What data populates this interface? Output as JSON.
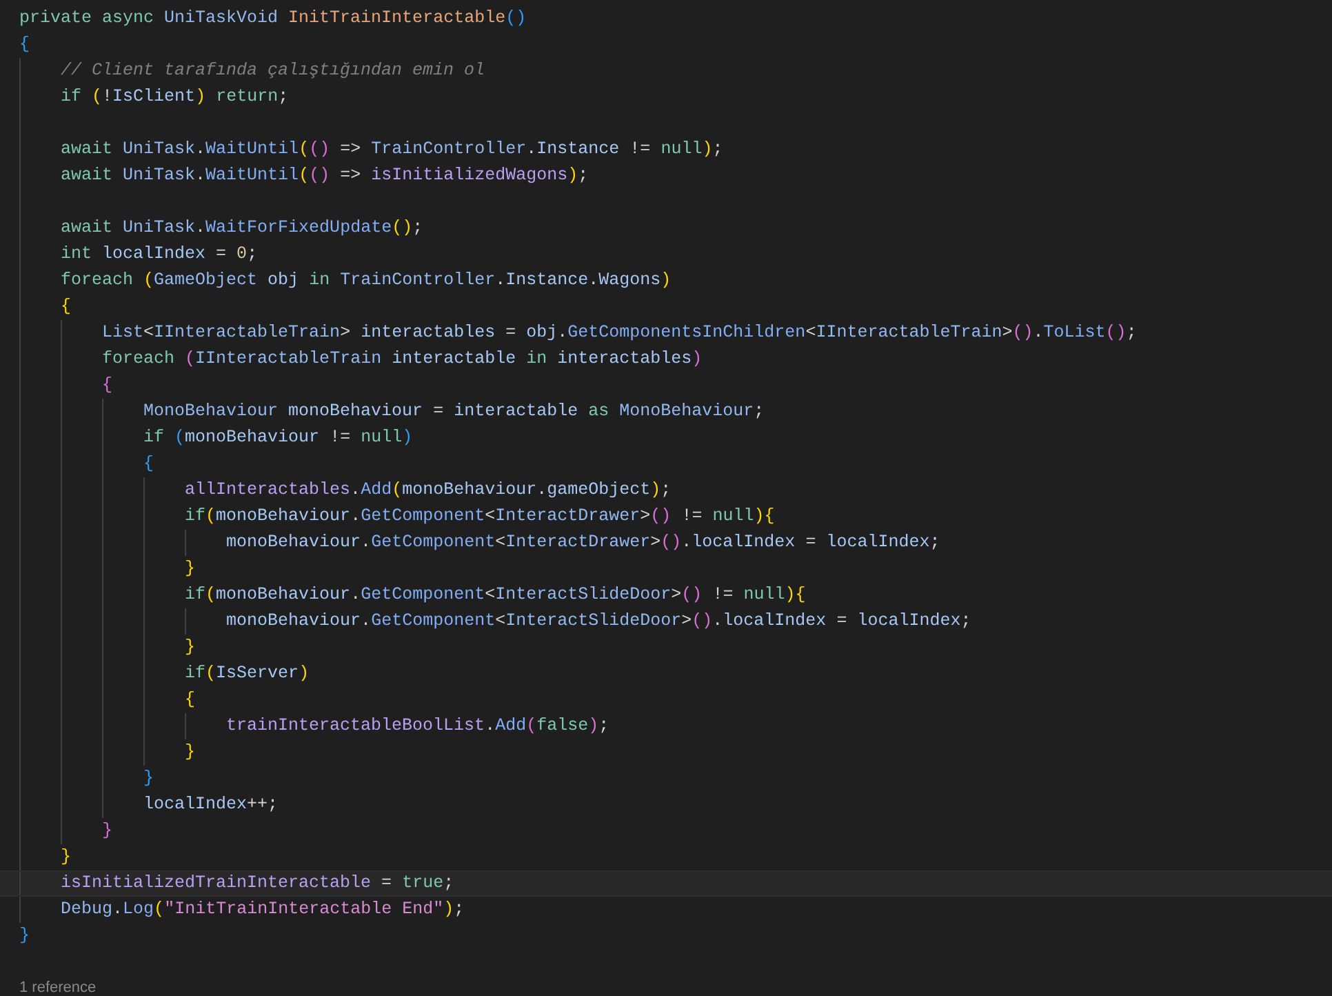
{
  "lines": [
    {
      "current": false,
      "tokens": [
        {
          "kind": "kw",
          "text": "private async "
        },
        {
          "kind": "type",
          "text": "UniTaskVoid "
        },
        {
          "kind": "decl",
          "text": "InitTrainInteractable"
        },
        {
          "kind": "b3",
          "text": "()"
        }
      ]
    },
    {
      "current": false,
      "tokens": [
        {
          "kind": "b3",
          "text": "{"
        }
      ]
    },
    {
      "current": false,
      "tokens": [
        {
          "kind": "comment",
          "text": "    // Client tarafında çalıştığından emin ol"
        }
      ]
    },
    {
      "current": false,
      "tokens": [
        {
          "kind": "kw",
          "text": "    if "
        },
        {
          "kind": "b1",
          "text": "("
        },
        {
          "kind": "p",
          "text": "!"
        },
        {
          "kind": "var",
          "text": "IsClient"
        },
        {
          "kind": "b1",
          "text": ")"
        },
        {
          "kind": "kw",
          "text": " return"
        },
        {
          "kind": "p",
          "text": ";"
        }
      ]
    },
    {
      "current": false
    },
    {
      "current": false,
      "tokens": [
        {
          "kind": "kw",
          "text": "    await "
        },
        {
          "kind": "type",
          "text": "UniTask"
        },
        {
          "kind": "p",
          "text": "."
        },
        {
          "kind": "fn",
          "text": "WaitUntil"
        },
        {
          "kind": "b1",
          "text": "("
        },
        {
          "kind": "b2",
          "text": "()"
        },
        {
          "kind": "p",
          "text": " => "
        },
        {
          "kind": "type",
          "text": "TrainController"
        },
        {
          "kind": "p",
          "text": "."
        },
        {
          "kind": "var",
          "text": "Instance"
        },
        {
          "kind": "p",
          "text": " != "
        },
        {
          "kind": "kw",
          "text": "null"
        },
        {
          "kind": "b1",
          "text": ")"
        },
        {
          "kind": "p",
          "text": ";"
        }
      ]
    },
    {
      "current": false,
      "tokens": [
        {
          "kind": "kw",
          "text": "    await "
        },
        {
          "kind": "type",
          "text": "UniTask"
        },
        {
          "kind": "p",
          "text": "."
        },
        {
          "kind": "fn",
          "text": "WaitUntil"
        },
        {
          "kind": "b1",
          "text": "("
        },
        {
          "kind": "b2",
          "text": "()"
        },
        {
          "kind": "p",
          "text": " => "
        },
        {
          "kind": "field",
          "text": "isInitializedWagons"
        },
        {
          "kind": "b1",
          "text": ")"
        },
        {
          "kind": "p",
          "text": ";"
        }
      ]
    },
    {
      "current": false
    },
    {
      "current": false,
      "tokens": [
        {
          "kind": "kw",
          "text": "    await "
        },
        {
          "kind": "type",
          "text": "UniTask"
        },
        {
          "kind": "p",
          "text": "."
        },
        {
          "kind": "fn",
          "text": "WaitForFixedUpdate"
        },
        {
          "kind": "b1",
          "text": "()"
        },
        {
          "kind": "p",
          "text": ";"
        }
      ]
    },
    {
      "current": false,
      "tokens": [
        {
          "kind": "kw",
          "text": "    int "
        },
        {
          "kind": "var",
          "text": "localIndex"
        },
        {
          "kind": "p",
          "text": " = "
        },
        {
          "kind": "num",
          "text": "0"
        },
        {
          "kind": "p",
          "text": ";"
        }
      ]
    },
    {
      "current": false,
      "tokens": [
        {
          "kind": "kw",
          "text": "    foreach "
        },
        {
          "kind": "b1",
          "text": "("
        },
        {
          "kind": "type",
          "text": "GameObject "
        },
        {
          "kind": "var",
          "text": "obj "
        },
        {
          "kind": "kw",
          "text": "in "
        },
        {
          "kind": "type",
          "text": "TrainController"
        },
        {
          "kind": "p",
          "text": "."
        },
        {
          "kind": "var",
          "text": "Instance"
        },
        {
          "kind": "p",
          "text": "."
        },
        {
          "kind": "var",
          "text": "Wagons"
        },
        {
          "kind": "b1",
          "text": ")"
        }
      ]
    },
    {
      "current": false,
      "tokens": [
        {
          "kind": "b1",
          "text": "    {"
        }
      ]
    },
    {
      "current": false,
      "tokens": [
        {
          "kind": "type",
          "text": "        List"
        },
        {
          "kind": "p",
          "text": "<"
        },
        {
          "kind": "type",
          "text": "IInteractableTrain"
        },
        {
          "kind": "p",
          "text": "> "
        },
        {
          "kind": "var",
          "text": "interactables"
        },
        {
          "kind": "p",
          "text": " = "
        },
        {
          "kind": "var",
          "text": "obj"
        },
        {
          "kind": "p",
          "text": "."
        },
        {
          "kind": "fn",
          "text": "GetComponentsInChildren"
        },
        {
          "kind": "p",
          "text": "<"
        },
        {
          "kind": "type",
          "text": "IInteractableTrain"
        },
        {
          "kind": "p",
          "text": ">"
        },
        {
          "kind": "b2",
          "text": "()"
        },
        {
          "kind": "p",
          "text": "."
        },
        {
          "kind": "fn",
          "text": "ToList"
        },
        {
          "kind": "b2",
          "text": "()"
        },
        {
          "kind": "p",
          "text": ";"
        }
      ]
    },
    {
      "current": false,
      "tokens": [
        {
          "kind": "kw",
          "text": "        foreach "
        },
        {
          "kind": "b2",
          "text": "("
        },
        {
          "kind": "type",
          "text": "IInteractableTrain "
        },
        {
          "kind": "var",
          "text": "interactable "
        },
        {
          "kind": "kw",
          "text": "in "
        },
        {
          "kind": "var",
          "text": "interactables"
        },
        {
          "kind": "b2",
          "text": ")"
        }
      ]
    },
    {
      "current": false,
      "tokens": [
        {
          "kind": "b2",
          "text": "        {"
        }
      ]
    },
    {
      "current": false,
      "tokens": [
        {
          "kind": "type",
          "text": "            MonoBehaviour "
        },
        {
          "kind": "var",
          "text": "monoBehaviour"
        },
        {
          "kind": "p",
          "text": " = "
        },
        {
          "kind": "var",
          "text": "interactable "
        },
        {
          "kind": "kw",
          "text": "as "
        },
        {
          "kind": "type",
          "text": "MonoBehaviour"
        },
        {
          "kind": "p",
          "text": ";"
        }
      ]
    },
    {
      "current": false,
      "tokens": [
        {
          "kind": "kw",
          "text": "            if "
        },
        {
          "kind": "b3",
          "text": "("
        },
        {
          "kind": "var",
          "text": "monoBehaviour"
        },
        {
          "kind": "p",
          "text": " != "
        },
        {
          "kind": "kw",
          "text": "null"
        },
        {
          "kind": "b3",
          "text": ")"
        }
      ]
    },
    {
      "current": false,
      "tokens": [
        {
          "kind": "b3",
          "text": "            {"
        }
      ]
    },
    {
      "current": false,
      "tokens": [
        {
          "kind": "field",
          "text": "                allInteractables"
        },
        {
          "kind": "p",
          "text": "."
        },
        {
          "kind": "fn",
          "text": "Add"
        },
        {
          "kind": "b1",
          "text": "("
        },
        {
          "kind": "var",
          "text": "monoBehaviour"
        },
        {
          "kind": "p",
          "text": "."
        },
        {
          "kind": "var",
          "text": "gameObject"
        },
        {
          "kind": "b1",
          "text": ")"
        },
        {
          "kind": "p",
          "text": ";"
        }
      ]
    },
    {
      "current": false,
      "tokens": [
        {
          "kind": "kw",
          "text": "                if"
        },
        {
          "kind": "b1",
          "text": "("
        },
        {
          "kind": "var",
          "text": "monoBehaviour"
        },
        {
          "kind": "p",
          "text": "."
        },
        {
          "kind": "fn",
          "text": "GetComponent"
        },
        {
          "kind": "p",
          "text": "<"
        },
        {
          "kind": "type",
          "text": "InteractDrawer"
        },
        {
          "kind": "p",
          "text": ">"
        },
        {
          "kind": "b2",
          "text": "()"
        },
        {
          "kind": "p",
          "text": " != "
        },
        {
          "kind": "kw",
          "text": "null"
        },
        {
          "kind": "b1",
          "text": "){"
        }
      ]
    },
    {
      "current": false,
      "tokens": [
        {
          "kind": "var",
          "text": "                    monoBehaviour"
        },
        {
          "kind": "p",
          "text": "."
        },
        {
          "kind": "fn",
          "text": "GetComponent"
        },
        {
          "kind": "p",
          "text": "<"
        },
        {
          "kind": "type",
          "text": "InteractDrawer"
        },
        {
          "kind": "p",
          "text": ">"
        },
        {
          "kind": "b2",
          "text": "()"
        },
        {
          "kind": "p",
          "text": "."
        },
        {
          "kind": "var",
          "text": "localIndex"
        },
        {
          "kind": "p",
          "text": " = "
        },
        {
          "kind": "var",
          "text": "localIndex"
        },
        {
          "kind": "p",
          "text": ";"
        }
      ]
    },
    {
      "current": false,
      "tokens": [
        {
          "kind": "b1",
          "text": "                }"
        }
      ]
    },
    {
      "current": false,
      "tokens": [
        {
          "kind": "kw",
          "text": "                if"
        },
        {
          "kind": "b1",
          "text": "("
        },
        {
          "kind": "var",
          "text": "monoBehaviour"
        },
        {
          "kind": "p",
          "text": "."
        },
        {
          "kind": "fn",
          "text": "GetComponent"
        },
        {
          "kind": "p",
          "text": "<"
        },
        {
          "kind": "type",
          "text": "InteractSlideDoor"
        },
        {
          "kind": "p",
          "text": ">"
        },
        {
          "kind": "b2",
          "text": "()"
        },
        {
          "kind": "p",
          "text": " != "
        },
        {
          "kind": "kw",
          "text": "null"
        },
        {
          "kind": "b1",
          "text": "){"
        }
      ]
    },
    {
      "current": false,
      "tokens": [
        {
          "kind": "var",
          "text": "                    monoBehaviour"
        },
        {
          "kind": "p",
          "text": "."
        },
        {
          "kind": "fn",
          "text": "GetComponent"
        },
        {
          "kind": "p",
          "text": "<"
        },
        {
          "kind": "type",
          "text": "InteractSlideDoor"
        },
        {
          "kind": "p",
          "text": ">"
        },
        {
          "kind": "b2",
          "text": "()"
        },
        {
          "kind": "p",
          "text": "."
        },
        {
          "kind": "var",
          "text": "localIndex"
        },
        {
          "kind": "p",
          "text": " = "
        },
        {
          "kind": "var",
          "text": "localIndex"
        },
        {
          "kind": "p",
          "text": ";"
        }
      ]
    },
    {
      "current": false,
      "tokens": [
        {
          "kind": "b1",
          "text": "                }"
        }
      ]
    },
    {
      "current": false,
      "tokens": [
        {
          "kind": "kw",
          "text": "                if"
        },
        {
          "kind": "b1",
          "text": "("
        },
        {
          "kind": "var",
          "text": "IsServer"
        },
        {
          "kind": "b1",
          "text": ")"
        }
      ]
    },
    {
      "current": false,
      "tokens": [
        {
          "kind": "b1",
          "text": "                {"
        }
      ]
    },
    {
      "current": false,
      "tokens": [
        {
          "kind": "field",
          "text": "                    trainInteractableBoolList"
        },
        {
          "kind": "p",
          "text": "."
        },
        {
          "kind": "fn",
          "text": "Add"
        },
        {
          "kind": "b2",
          "text": "("
        },
        {
          "kind": "kw",
          "text": "false"
        },
        {
          "kind": "b2",
          "text": ")"
        },
        {
          "kind": "p",
          "text": ";"
        }
      ]
    },
    {
      "current": false,
      "tokens": [
        {
          "kind": "b1",
          "text": "                }"
        }
      ]
    },
    {
      "current": false,
      "tokens": [
        {
          "kind": "b3",
          "text": "            }"
        }
      ]
    },
    {
      "current": false,
      "tokens": [
        {
          "kind": "var",
          "text": "            localIndex"
        },
        {
          "kind": "p",
          "text": "++;"
        }
      ]
    },
    {
      "current": false,
      "tokens": [
        {
          "kind": "b2",
          "text": "        }"
        }
      ]
    },
    {
      "current": false,
      "tokens": [
        {
          "kind": "b1",
          "text": "    }"
        }
      ]
    },
    {
      "current": true,
      "tokens": [
        {
          "kind": "field",
          "text": "    isInitializedTrainInteractable"
        },
        {
          "kind": "p",
          "text": " = "
        },
        {
          "kind": "kw",
          "text": "true"
        },
        {
          "kind": "p",
          "text": ";"
        }
      ]
    },
    {
      "current": false,
      "tokens": [
        {
          "kind": "type",
          "text": "    Debug"
        },
        {
          "kind": "p",
          "text": "."
        },
        {
          "kind": "fn",
          "text": "Log"
        },
        {
          "kind": "b1",
          "text": "("
        },
        {
          "kind": "str",
          "text": "\"InitTrainInteractable End\""
        },
        {
          "kind": "b1",
          "text": ")"
        },
        {
          "kind": "p",
          "text": ";"
        }
      ]
    },
    {
      "current": false,
      "tokens": [
        {
          "kind": "b3",
          "text": "}"
        }
      ]
    },
    {
      "current": false
    }
  ],
  "codelens": "1 reference"
}
